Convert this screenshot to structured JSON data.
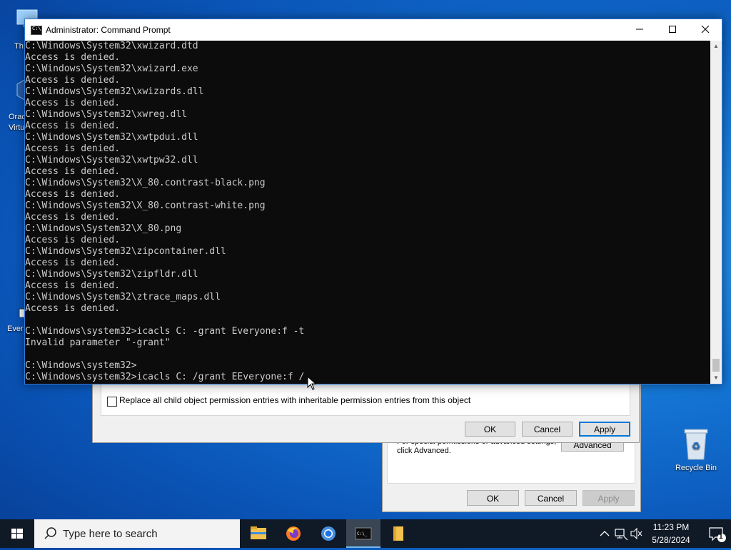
{
  "desktop": {
    "icons_left": [
      {
        "label": "Th"
      },
      {
        "label": "Orac"
      },
      {
        "label": "Virtu"
      },
      {
        "label": "Ever"
      }
    ],
    "recycle_bin": {
      "label": "Recycle Bin"
    }
  },
  "cmd": {
    "title": "Administrator: Command Prompt",
    "lines": [
      "C:\\Windows\\System32\\xwizard.dtd",
      "Access is denied.",
      "C:\\Windows\\System32\\xwizard.exe",
      "Access is denied.",
      "C:\\Windows\\System32\\xwizards.dll",
      "Access is denied.",
      "C:\\Windows\\System32\\xwreg.dll",
      "Access is denied.",
      "C:\\Windows\\System32\\xwtpdui.dll",
      "Access is denied.",
      "C:\\Windows\\System32\\xwtpw32.dll",
      "Access is denied.",
      "C:\\Windows\\System32\\X_80.contrast-black.png",
      "Access is denied.",
      "C:\\Windows\\System32\\X_80.contrast-white.png",
      "Access is denied.",
      "C:\\Windows\\System32\\X_80.png",
      "Access is denied.",
      "C:\\Windows\\System32\\zipcontainer.dll",
      "Access is denied.",
      "C:\\Windows\\System32\\zipfldr.dll",
      "Access is denied.",
      "C:\\Windows\\System32\\ztrace_maps.dll",
      "Access is denied.",
      "",
      "C:\\Windows\\system32>icacls C: -grant Everyone:f -t",
      "Invalid parameter \"-grant\"",
      "",
      "C:\\Windows\\system32>",
      "C:\\Windows\\system32>icacls C: /grant EEveryone:f /"
    ],
    "minimize": "—",
    "maximize": "☐",
    "close": "✕"
  },
  "advanced_dialog": {
    "checkbox_label": "Replace all child object permission entries with inheritable permission entries from this object",
    "ok": "OK",
    "cancel": "Cancel",
    "apply": "Apply"
  },
  "properties_dialog": {
    "text_line1": "For special permissions or advanced settings,",
    "text_line2": "click Advanced.",
    "advanced": "Advanced",
    "ok": "OK",
    "cancel": "Cancel",
    "apply": "Apply"
  },
  "taskbar": {
    "search_placeholder": "Type here to search",
    "time": "11:23 PM",
    "date": "5/28/2024",
    "notification_count": "1"
  }
}
